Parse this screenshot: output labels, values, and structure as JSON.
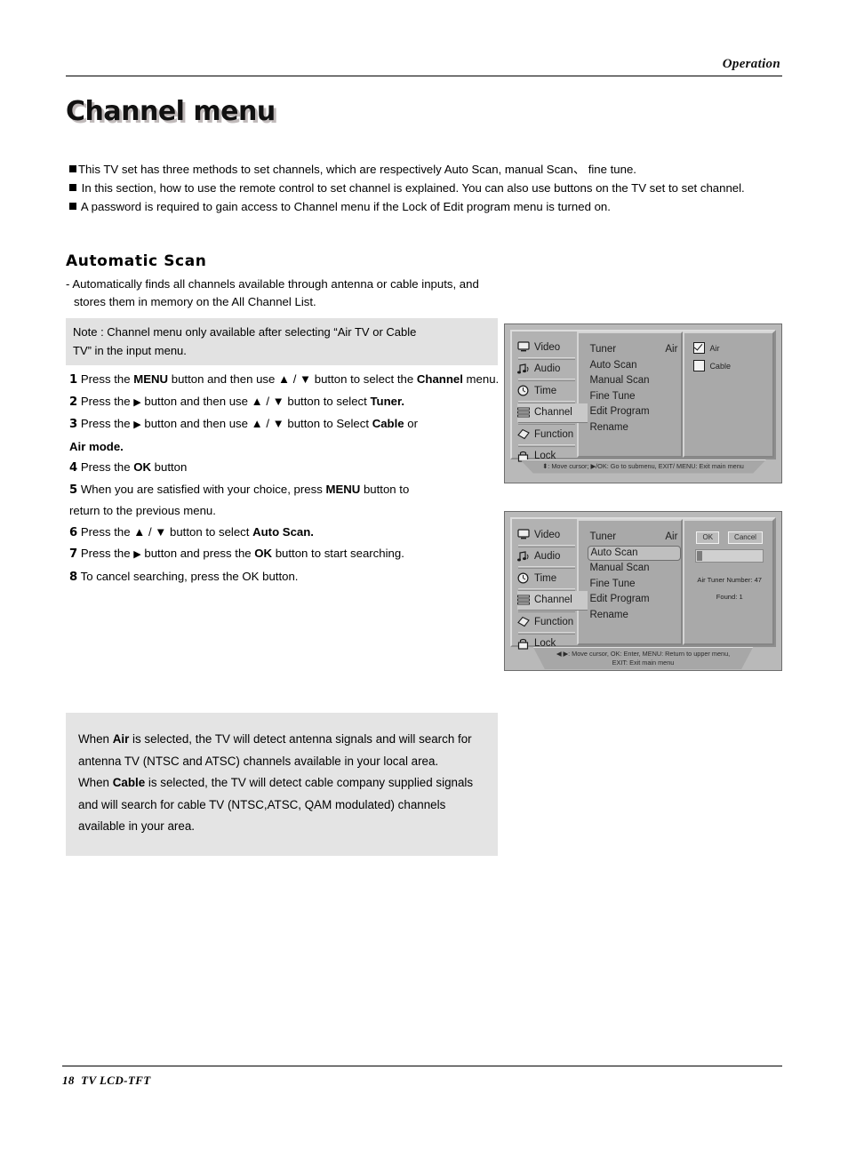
{
  "header": {
    "section_label": "Operation"
  },
  "page_title": "Channel menu",
  "intro": {
    "bullets": [
      "This TV set has three methods to set channels, which are respectively Auto Scan,  manual Scan、 fine tune.",
      " In this section, how to use the remote control  to set channel is explained. You can also use buttons on the TV set to set channel.",
      " A password is required to gain access to Channel menu if the Lock of Edit program menu is turned on."
    ]
  },
  "section": {
    "heading": "Automatic Scan",
    "desc_line1": "- Automatically finds all channels available through antenna or cable inputs, and",
    "desc_line2": "stores them in memory on the All Channel List."
  },
  "note_box": {
    "line1": "Note : Channel menu only available after selecting  “Air TV or Cable",
    "line2": "TV” in the input menu."
  },
  "steps": [
    {
      "num": "1",
      "text_parts": [
        "Press the ",
        "MENU",
        " button and then use ▲ / ▼ button to select the "
      ],
      "bold_tail": "Channel",
      "tail": " menu."
    },
    {
      "num": "2",
      "text_parts": [
        "Press the ",
        "▶",
        " button and then use ▲ / ▼ button to select "
      ],
      "bold_tail": "Tuner.",
      "tail": ""
    },
    {
      "num": "3",
      "text_parts": [
        "Press the ",
        "▶",
        " button and then use ▲ / ▼ button to Select "
      ],
      "bold_tail": "Cable",
      "tail": " or"
    },
    {
      "num": "4",
      "text_parts": [
        "Press the ",
        "OK",
        " button"
      ],
      "bold_tail": "",
      "tail": ""
    },
    {
      "num": "5",
      "text_parts": [
        "When you are satisfied with your choice,  press ",
        "MENU",
        " button to "
      ],
      "bold_tail": "",
      "tail": "return to the previous menu."
    },
    {
      "num": "6",
      "text_parts": [
        "Press the  ▲ / ▼ button to select ",
        "",
        ""
      ],
      "bold_tail": "Auto Scan.",
      "tail": ""
    },
    {
      "num": "7",
      "text_parts": [
        "Press the ",
        "▶",
        " button and press the "
      ],
      "bold_tail": "OK",
      "tail": " button to start searching."
    },
    {
      "num": "8",
      "text_parts": [
        "To cancel searching, press the OK button.",
        "",
        ""
      ],
      "bold_tail": "",
      "tail": ""
    }
  ],
  "step3_second_line": {
    "bold": "Air",
    "rest": "  mode."
  },
  "explain_box": {
    "para1_pre": "When ",
    "para1_bold": "Air",
    "para1_post": " is selected, the TV will detect antenna signals and will search for antenna TV (NTSC and ATSC) channels available in your local area.",
    "para2_pre": "When ",
    "para2_bold": "Cable",
    "para2_post": " is selected, the TV will detect cable company supplied signals and will search for cable TV (NTSC,ATSC, QAM modulated) channels available in your area."
  },
  "osd": {
    "sidebar_items": [
      {
        "label": "Video",
        "icon": "monitor-icon",
        "active": false
      },
      {
        "label": "Audio",
        "icon": "music-note-icon",
        "active": false
      },
      {
        "label": "Time",
        "icon": "clock-icon",
        "active": false
      },
      {
        "label": "Channel",
        "icon": "channel-icon",
        "active": true
      },
      {
        "label": "Function",
        "icon": "diamond-icon",
        "active": false
      },
      {
        "label": "Lock",
        "icon": "lock-icon",
        "active": false
      }
    ],
    "menu_items": [
      {
        "label": "Tuner",
        "value": "Air"
      },
      {
        "label": "Auto Scan",
        "value": ""
      },
      {
        "label": "Manual Scan",
        "value": ""
      },
      {
        "label": "Fine Tune",
        "value": ""
      },
      {
        "label": "Edit Program",
        "value": ""
      },
      {
        "label": "Rename",
        "value": ""
      }
    ],
    "panel_a": {
      "checkboxes": [
        {
          "label": "Air",
          "checked": true
        },
        {
          "label": "Cable",
          "checked": false
        }
      ],
      "footer": "⬍: Move cursor;  ▶/OK: Go to submenu, EXIT/ MENU: Exit main menu"
    },
    "panel_b": {
      "selected_menu_item": "Auto Scan",
      "ok_label": "OK",
      "cancel_label": "Cancel",
      "progress_percent": 8,
      "info_line1": "Air Tuner Number: 47",
      "info_line2": "Found:          1",
      "footer": "◀ ▶: Move cursor,   OK: Enter, MENU: Return to upper menu,\nEXIT: Exit main menu"
    }
  },
  "footer": {
    "page_number": "18",
    "model": "TV LCD-TFT"
  }
}
